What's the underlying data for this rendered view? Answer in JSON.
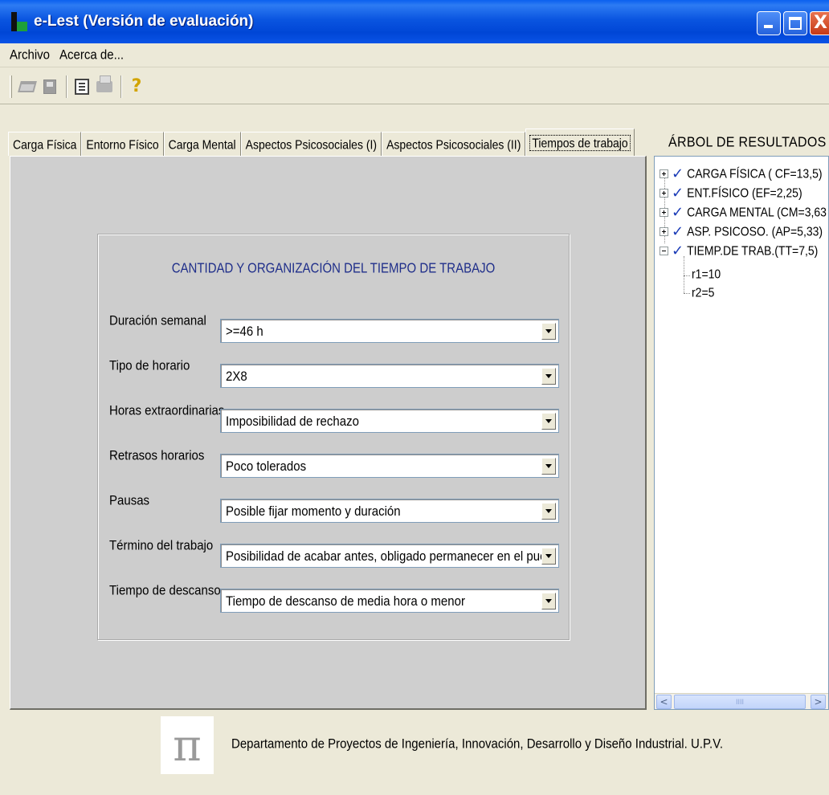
{
  "window": {
    "title": "e-Lest  (Versión de evaluación)",
    "controls": {
      "minimize": "minimize",
      "maximize": "maximize",
      "close": "X"
    }
  },
  "menu": [
    "Archivo",
    "Acerca de..."
  ],
  "toolbar": {
    "icons": [
      "open-icon",
      "save-icon",
      "properties-icon",
      "print-icon",
      "help-icon"
    ],
    "help_glyph": "?"
  },
  "tabs": [
    "Carga Física",
    "Entorno Físico",
    "Carga Mental",
    "Aspectos Psicosociales (I)",
    "Aspectos Psicosociales (II)",
    "Tiempos de trabajo"
  ],
  "active_tab": "Tiempos de trabajo",
  "form": {
    "title": "CANTIDAD Y ORGANIZACIÓN DEL TIEMPO DE TRABAJO",
    "fields": [
      {
        "label": "Duración semanal",
        "value": ">=46 h"
      },
      {
        "label": "Tipo de horario",
        "value": "2X8"
      },
      {
        "label": "Horas extraordinarias",
        "value": "Imposibilidad de rechazo"
      },
      {
        "label": "Retrasos horarios",
        "value": "Poco tolerados"
      },
      {
        "label": "Pausas",
        "value": "Posible fijar momento y duración"
      },
      {
        "label": "Término del trabajo",
        "value": "Posibilidad de acabar antes, obligado permanecer en el puesto"
      },
      {
        "label": "Tiempo de descanso",
        "value": "Tiempo de descanso de media hora o menor"
      }
    ]
  },
  "results_tree": {
    "title": "ÁRBOL DE RESULTADOS",
    "nodes": [
      {
        "label": "CARGA FÍSICA ( CF=13,5)",
        "expanded": false
      },
      {
        "label": "ENT.FÍSICO (EF=2,25)",
        "expanded": false
      },
      {
        "label": "CARGA MENTAL (CM=3,63",
        "expanded": false
      },
      {
        "label": "ASP. PSICOSO. (AP=5,33)",
        "expanded": false
      },
      {
        "label": "TIEMP.DE TRAB.(TT=7,5)",
        "expanded": true
      }
    ],
    "children": [
      "r1=10",
      "r2=5"
    ],
    "check_glyph": "✓"
  },
  "scrollbar": {
    "left_arrow": "<",
    "right_arrow": ">",
    "grip": "IIII"
  },
  "footer": {
    "logo_glyph": "π",
    "text": "Departamento de Proyectos de Ingeniería, Innovación, Desarrollo y Diseño Industrial. U.P.V."
  },
  "colors": {
    "titlebar": "#0a55e0",
    "panel": "#cfcfcf",
    "form_title": "#1f2e8a",
    "check": "#1a3bb7"
  }
}
